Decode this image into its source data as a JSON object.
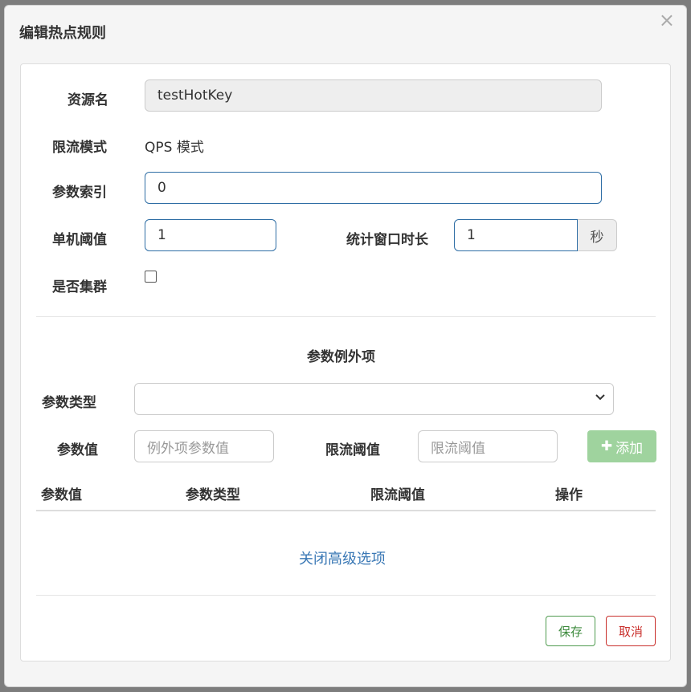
{
  "dialog": {
    "title": "编辑热点规则",
    "close": "×"
  },
  "form": {
    "resource_label": "资源名",
    "resource_value": "testHotKey",
    "mode_label": "限流模式",
    "mode_value": "QPS 模式",
    "param_index_label": "参数索引",
    "param_index_value": "0",
    "threshold_label": "单机阈值",
    "threshold_value": "1",
    "window_label": "统计窗口时长",
    "window_value": "1",
    "window_unit": "秒",
    "cluster_label": "是否集群",
    "cluster_checked": false
  },
  "exceptions": {
    "section_title": "参数例外项",
    "type_label": "参数类型",
    "type_value": "",
    "value_label": "参数值",
    "value_placeholder": "例外项参数值",
    "limit_label": "限流阈值",
    "limit_placeholder": "限流阈值",
    "add_button": "添加",
    "columns": [
      "参数值",
      "参数类型",
      "限流阈值",
      "操作"
    ],
    "rows": []
  },
  "advanced_link": "关闭高级选项",
  "footer": {
    "save": "保存",
    "cancel": "取消"
  },
  "colors": {
    "accent_blue": "#2f6ea5",
    "link_blue": "#3a78b5",
    "add_green": "#9fd39e",
    "save_green": "#3c8a3c",
    "cancel_red": "#c9302c"
  }
}
